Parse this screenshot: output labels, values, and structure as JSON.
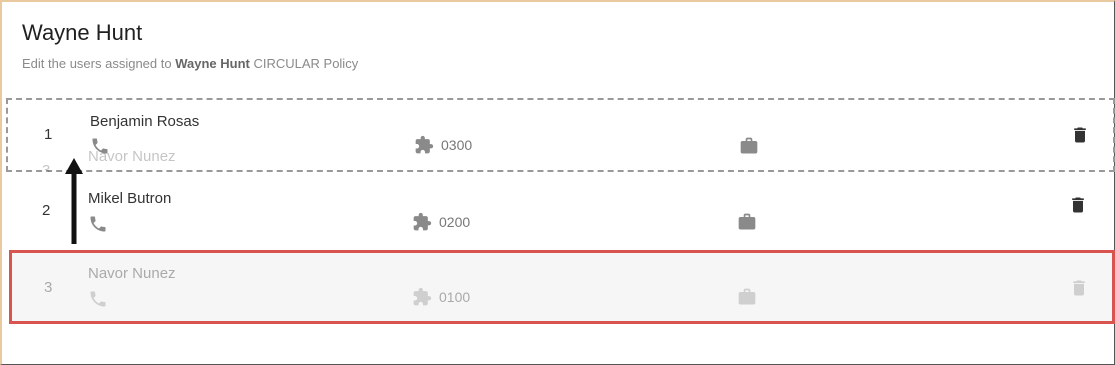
{
  "header": {
    "title": "Wayne Hunt",
    "subtitle_prefix": "Edit the users assigned to ",
    "subtitle_bold": "Wayne Hunt",
    "subtitle_suffix": " CIRCULAR Policy"
  },
  "users": [
    {
      "index": "1",
      "name": "Benjamin Rosas",
      "code": "0300",
      "phone_icon": "phone-icon",
      "extension_icon": "puzzle-icon",
      "work_icon": "briefcase-icon",
      "delete_icon": "trash-icon"
    },
    {
      "index": "2",
      "name": "Mikel Butron",
      "code": "0200",
      "phone_icon": "phone-icon",
      "extension_icon": "puzzle-icon",
      "work_icon": "briefcase-icon",
      "delete_icon": "trash-icon"
    },
    {
      "index": "3",
      "name": "Navor Nunez",
      "code": "0100",
      "phone_icon": "phone-icon",
      "extension_icon": "puzzle-icon",
      "work_icon": "briefcase-icon",
      "delete_icon": "trash-icon"
    }
  ],
  "drag_preview": {
    "index": "3",
    "name": "Navor Nunez",
    "code": "0100"
  },
  "colors": {
    "highlight_border": "#d9534f",
    "drop_target_border": "#999999",
    "icon": "#8a8a8a",
    "icon_dark": "#333333"
  }
}
